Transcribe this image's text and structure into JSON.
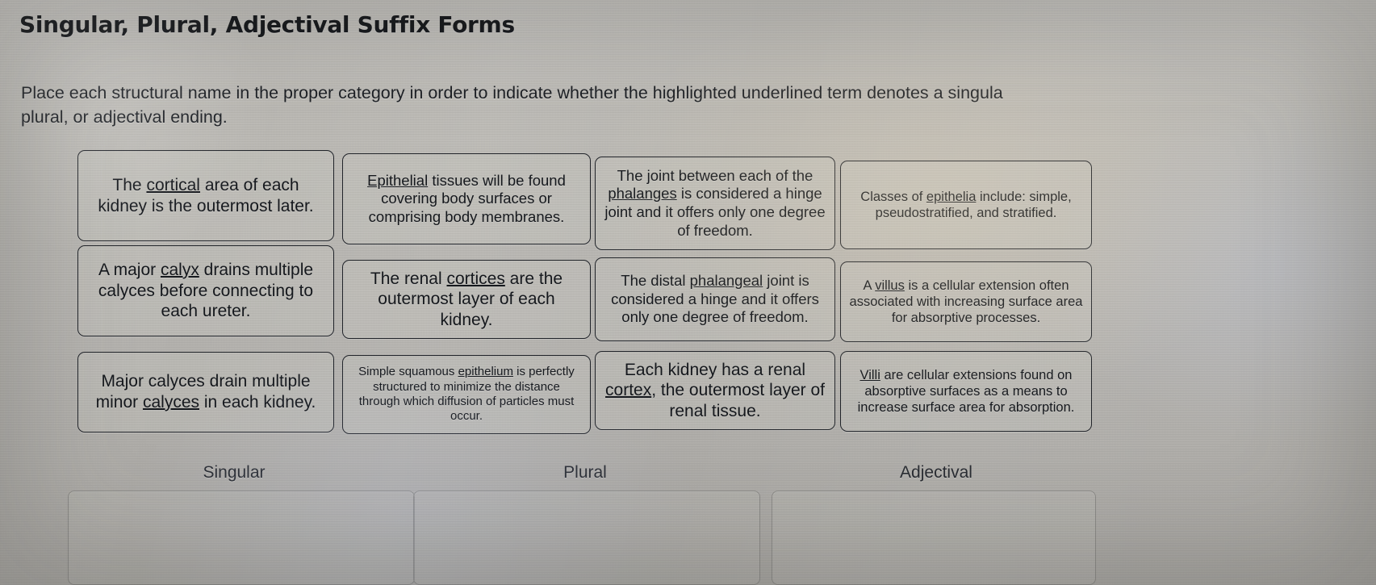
{
  "page": {
    "title": "Singular, Plural, Adjectival Suffix Forms",
    "instructions_line1": "Place each structural name in the proper category in order to indicate whether the highlighted underlined term denotes a singula",
    "instructions_line2": "plural, or adjectival ending."
  },
  "cards": [
    {
      "id": "card-cortical",
      "column": 1,
      "row": 1,
      "text": "The cortical area of each kidney is the outermost later.",
      "underlined": "cortical",
      "parts": {
        "before": "The ",
        "term": "cortical",
        "after": " area of each kidney is the outermost later."
      }
    },
    {
      "id": "card-epithelial",
      "column": 2,
      "row": 1,
      "text": "Epithelial tissues will be found covering body surfaces or comprising body membranes.",
      "underlined": "Epithelial",
      "parts": {
        "before": "",
        "term": "Epithelial",
        "after": " tissues will be found covering body surfaces or comprising body membranes."
      }
    },
    {
      "id": "card-phalanges",
      "column": 3,
      "row": 1,
      "text": "The joint between each of the phalanges is considered a hinge joint and it offers only one degree of freedom.",
      "underlined": "phalanges",
      "parts": {
        "before": "The joint between each of the ",
        "term": "phalanges",
        "after": " is considered a hinge joint and it offers only one degree of freedom."
      }
    },
    {
      "id": "card-epithelia",
      "column": 4,
      "row": 1,
      "text": "Classes of epithelia include: simple, pseudostratified, and stratified.",
      "underlined": "epithelia",
      "parts": {
        "before": "Classes of ",
        "term": "epithelia",
        "after": " include: simple, pseudostratified, and stratified."
      }
    },
    {
      "id": "card-calyx",
      "column": 1,
      "row": 2,
      "text": "A major calyx drains multiple calyces before connecting to each ureter.",
      "underlined": "calyx",
      "parts": {
        "before": "A major ",
        "term": "calyx",
        "after": " drains multiple calyces before connecting to each ureter."
      }
    },
    {
      "id": "card-cortices",
      "column": 2,
      "row": 2,
      "text": "The renal cortices are the outermost layer of each kidney.",
      "underlined": "cortices",
      "parts": {
        "before": "The renal ",
        "term": "cortices",
        "after": " are the outermost layer of each kidney."
      }
    },
    {
      "id": "card-phalangeal",
      "column": 3,
      "row": 2,
      "text": "The distal phalangeal joint is considered a hinge and it offers only one degree of freedom.",
      "underlined": "phalangeal",
      "parts": {
        "before": "The distal ",
        "term": "phalangeal",
        "after": " joint is considered a hinge and it offers only one degree of freedom."
      }
    },
    {
      "id": "card-villus",
      "column": 4,
      "row": 2,
      "text": "A villus is a cellular extension often associated with increasing surface area for absorptive processes.",
      "underlined": "villus",
      "parts": {
        "before": "A ",
        "term": "villus",
        "after": " is a cellular extension often associated with increasing surface area for absorptive processes."
      }
    },
    {
      "id": "card-calyces",
      "column": 1,
      "row": 3,
      "text": "Major calyces drain multiple minor calyces in each kidney.",
      "underlined": "calyces",
      "parts": {
        "before": "Major calyces drain multiple minor ",
        "term": "calyces",
        "after": " in each kidney."
      }
    },
    {
      "id": "card-epithelium",
      "column": 2,
      "row": 3,
      "text": "Simple squamous epithelium is perfectly structured to minimize the distance through which diffusion of particles must occur.",
      "underlined": "epithelium",
      "parts": {
        "before": "Simple squamous ",
        "term": "epithelium",
        "after": " is perfectly structured to minimize the distance through which diffusion of particles must occur."
      }
    },
    {
      "id": "card-cortex",
      "column": 3,
      "row": 3,
      "text": "Each kidney has a renal cortex, the outermost layer of renal tissue.",
      "underlined": "cortex",
      "parts": {
        "before": "Each kidney has a renal ",
        "term": "cortex",
        "after": ", the outermost layer of renal tissue."
      }
    },
    {
      "id": "card-villi",
      "column": 4,
      "row": 3,
      "text": "Villi are cellular extensions found on absorptive surfaces as a means to increase surface area for absorption.",
      "underlined": "Villi",
      "parts": {
        "before": "",
        "term": "Villi",
        "after": " are cellular extensions found on absorptive surfaces as a means to increase surface area for absorption."
      }
    }
  ],
  "categories": [
    {
      "id": "singular",
      "label": "Singular"
    },
    {
      "id": "plural",
      "label": "Plural"
    },
    {
      "id": "adjectival",
      "label": "Adjectival"
    }
  ],
  "colors": {
    "background": "#b9b7b2",
    "card_border": "#21242a",
    "text": "#15181d",
    "dropzone_border": "#8d8c89"
  }
}
